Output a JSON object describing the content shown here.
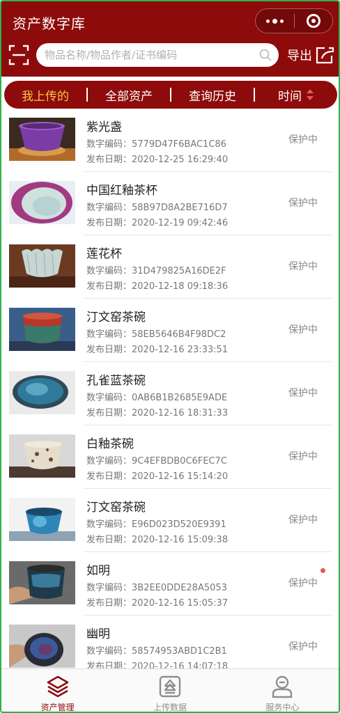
{
  "header": {
    "title": "资产数字库",
    "search_placeholder": "物品名称/物品作者/证书编码",
    "export_label": "导出"
  },
  "filters": [
    {
      "label": "我上传的",
      "active": true
    },
    {
      "label": "全部资产",
      "active": false
    },
    {
      "label": "查询历史",
      "active": false
    },
    {
      "label": "时间",
      "active": false
    }
  ],
  "items": [
    {
      "name": "紫光盏",
      "code_label": "数字编码：",
      "code": "5779D47F6BAC1C86",
      "date_label": "发布日期：",
      "date": "2020-12-25 16:29:40",
      "status": "保护中"
    },
    {
      "name": "中国红釉茶杯",
      "code_label": "数字编码：",
      "code": "58B97D8A2BE716D7",
      "date_label": "发布日期：",
      "date": "2020-12-19 09:42:46",
      "status": "保护中"
    },
    {
      "name": "莲花杯",
      "code_label": "数字编码：",
      "code": "31D479825A16DE2F",
      "date_label": "发布日期：",
      "date": "2020-12-18 09:18:36",
      "status": "保护中"
    },
    {
      "name": "汀文窑茶碗",
      "code_label": "数字编码：",
      "code": "58EB5646B4F98DC2",
      "date_label": "发布日期：",
      "date": "2020-12-16 23:33:51",
      "status": "保护中"
    },
    {
      "name": "孔雀蓝茶碗",
      "code_label": "数字编码：",
      "code": "0AB6B1B2685E9ADE",
      "date_label": "发布日期：",
      "date": "2020-12-16 18:31:33",
      "status": "保护中"
    },
    {
      "name": "白釉茶碗",
      "code_label": "数字编码：",
      "code": "9C4EFBDB0C6FEC7C",
      "date_label": "发布日期：",
      "date": "2020-12-16 15:14:20",
      "status": "保护中"
    },
    {
      "name": "汀文窑茶碗",
      "code_label": "数字编码：",
      "code": "E96D023D520E9391",
      "date_label": "发布日期：",
      "date": "2020-12-16 15:09:38",
      "status": "保护中"
    },
    {
      "name": "如明",
      "code_label": "数字编码：",
      "code": "3B2EE0DDE28A5053",
      "date_label": "发布日期：",
      "date": "2020-12-16 15:05:37",
      "status": "保护中"
    },
    {
      "name": "幽明",
      "code_label": "数字编码：",
      "code": "58574953ABD1C2B1",
      "date_label": "发布日期：",
      "date": "2020-12-16 14:07:18",
      "status": "保护中"
    }
  ],
  "tabs": [
    {
      "label": "资产管理",
      "icon": "layers-icon",
      "active": true
    },
    {
      "label": "上传数据",
      "icon": "upload-icon",
      "active": false
    },
    {
      "label": "服务中心",
      "icon": "user-icon",
      "active": false
    }
  ],
  "colors": {
    "brand": "#8e0b0b",
    "active_filter": "#f3c84a",
    "notification_dot": "#e8584a"
  }
}
